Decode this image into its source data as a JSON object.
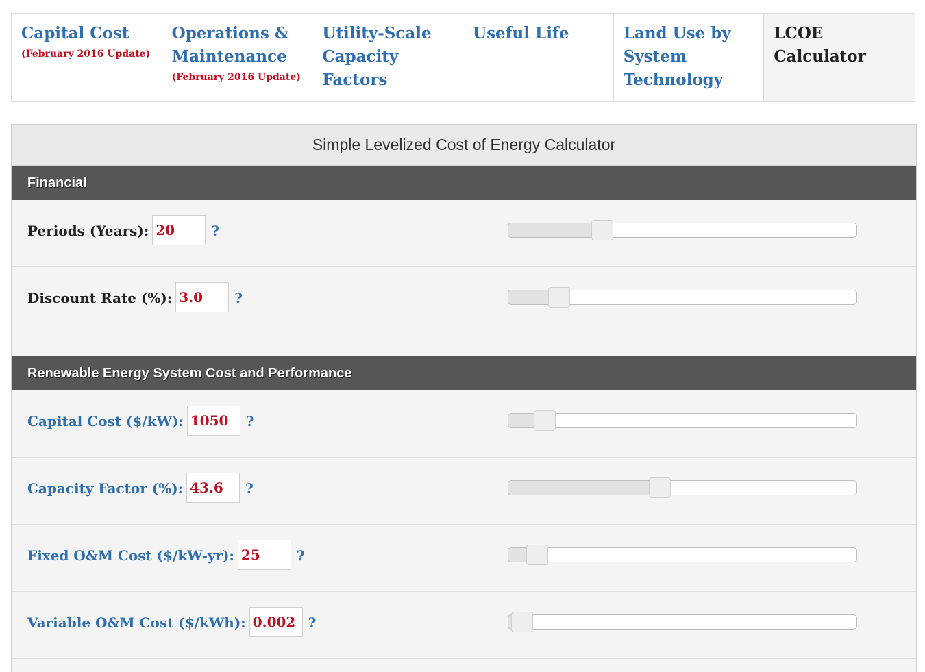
{
  "tabs": [
    {
      "title": "Capital Cost",
      "subtitle": "(February 2016 Update)",
      "active": false
    },
    {
      "title": "Operations & Maintenance",
      "subtitle": "(February 2016 Update)",
      "active": false
    },
    {
      "title": "Utility-Scale Capacity Factors",
      "subtitle": "",
      "active": false
    },
    {
      "title": "Useful Life",
      "subtitle": "",
      "active": false
    },
    {
      "title": "Land Use by System Technology",
      "subtitle": "",
      "active": false
    },
    {
      "title": "LCOE Calculator",
      "subtitle": "",
      "active": true
    }
  ],
  "calculator": {
    "title": "Simple Levelized Cost of Energy Calculator",
    "help_symbol": "?",
    "financial": {
      "header": "Financial",
      "fields": [
        {
          "label": "Periods (Years):",
          "value": "20",
          "slider_fraction": 0.27
        },
        {
          "label": "Discount Rate (%):",
          "value": "3.0",
          "slider_fraction": 0.145
        }
      ]
    },
    "renewable": {
      "header": "Renewable Energy System Cost and Performance",
      "fields": [
        {
          "label": "Capital Cost ($/kW):",
          "value": "1050",
          "slider_fraction": 0.105
        },
        {
          "label": "Capacity Factor (%):",
          "value": "43.6",
          "slider_fraction": 0.435
        },
        {
          "label": "Fixed O&M Cost ($/kW-yr):",
          "value": "25",
          "slider_fraction": 0.083
        },
        {
          "label": "Variable O&M Cost ($/kWh):",
          "value": "0.002",
          "slider_fraction": 0.04
        }
      ]
    }
  }
}
